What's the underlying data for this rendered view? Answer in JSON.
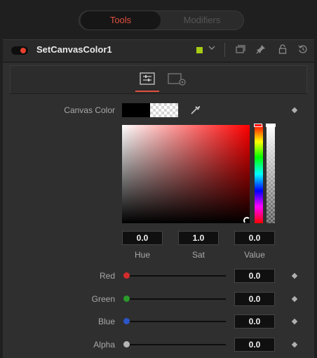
{
  "top_tabs": {
    "tools": "Tools",
    "modifiers": "Modifiers"
  },
  "tool": {
    "name": "SetCanvasColor1",
    "color": "#a6cc13",
    "enabled_color": "#e8402e"
  },
  "accent": "#e2503e",
  "canvas_color": {
    "label": "Canvas Color"
  },
  "hsv": {
    "hue": {
      "label": "Hue",
      "value": "0.0"
    },
    "sat": {
      "label": "Sat",
      "value": "1.0"
    },
    "value": {
      "label": "Value",
      "value": "0.0"
    }
  },
  "channels": [
    {
      "label": "Red",
      "value": "0.0",
      "color": "#d42b2b"
    },
    {
      "label": "Green",
      "value": "0.0",
      "color": "#2a9a2a"
    },
    {
      "label": "Blue",
      "value": "0.0",
      "color": "#2b55c8"
    },
    {
      "label": "Alpha",
      "value": "0.0",
      "color": "#b5b5b5"
    }
  ]
}
